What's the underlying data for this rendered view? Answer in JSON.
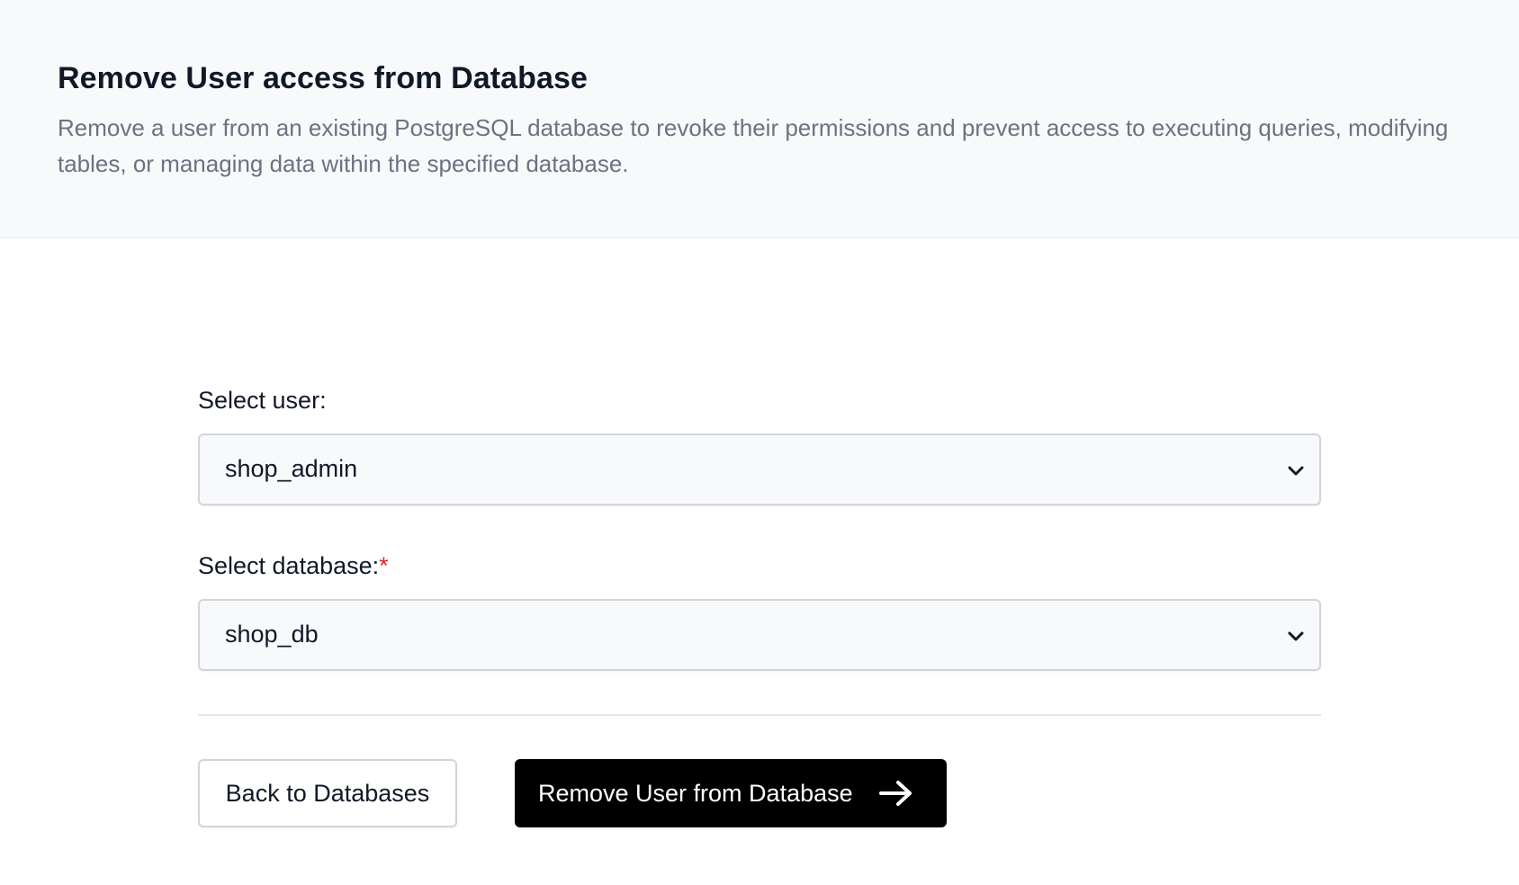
{
  "header": {
    "title": "Remove User access from Database",
    "description": "Remove a user from an existing PostgreSQL database to revoke their permissions and prevent access to executing queries, modifying tables, or managing data within the specified database."
  },
  "form": {
    "user": {
      "label": "Select user:",
      "value": "shop_admin",
      "icon": "chevron-down-icon"
    },
    "database": {
      "label": "Select database:",
      "required_marker": "*",
      "value": "shop_db",
      "icon": "chevron-down-icon"
    }
  },
  "actions": {
    "back_label": "Back to Databases",
    "submit_label": "Remove User from Database",
    "submit_icon": "arrow-right-icon"
  },
  "colors": {
    "primary": "#000000",
    "required": "#dc2626",
    "header_bg": "#f8f9fb",
    "muted_text": "#6b7280"
  }
}
